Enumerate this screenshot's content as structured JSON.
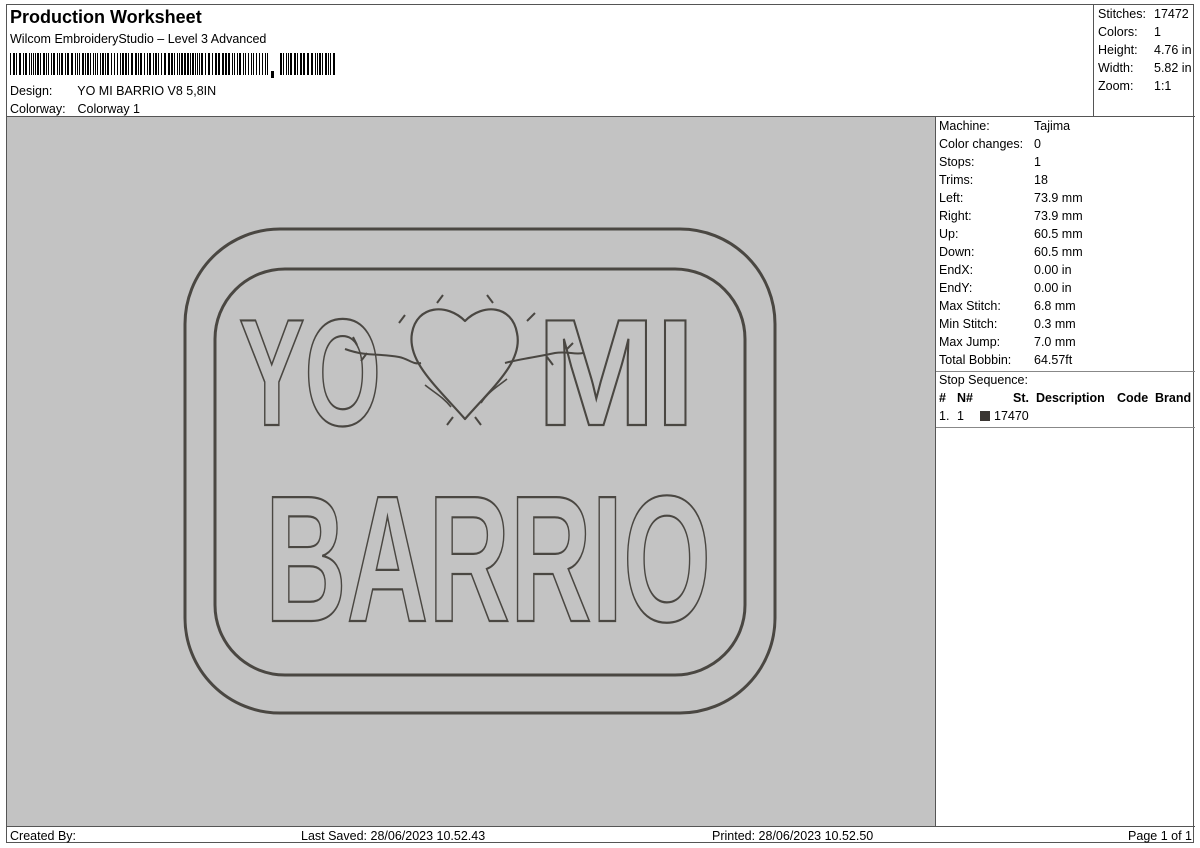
{
  "header": {
    "title": "Production Worksheet",
    "software": "Wilcom EmbroideryStudio – Level 3 Advanced",
    "barcode_label": "Barcode",
    "design_label": "Design:",
    "design_value": "YO MI BARRIO V8 5,8IN",
    "colorway_label": "Colorway:",
    "colorway_value": "Colorway 1"
  },
  "summary": {
    "stitches_label": "Stitches:",
    "stitches": "17472",
    "colors_label": "Colors:",
    "colors": "1",
    "height_label": "Height:",
    "height": "4.76 in",
    "width_label": "Width:",
    "width": "5.82 in",
    "zoom_label": "Zoom:",
    "zoom": "1:1"
  },
  "machine_info": [
    {
      "label": "Machine:",
      "value": "Tajima"
    },
    {
      "label": "Color changes:",
      "value": "0"
    },
    {
      "label": "Stops:",
      "value": "1"
    },
    {
      "label": "Trims:",
      "value": "18"
    },
    {
      "label": "Left:",
      "value": "73.9 mm"
    },
    {
      "label": "Right:",
      "value": "73.9 mm"
    },
    {
      "label": "Up:",
      "value": "60.5 mm"
    },
    {
      "label": "Down:",
      "value": "60.5 mm"
    },
    {
      "label": "EndX:",
      "value": "0.00 in"
    },
    {
      "label": "EndY:",
      "value": "0.00 in"
    },
    {
      "label": "Max Stitch:",
      "value": "6.8 mm"
    },
    {
      "label": "Min Stitch:",
      "value": "0.3 mm"
    },
    {
      "label": "Max Jump:",
      "value": "7.0 mm"
    },
    {
      "label": "Total Bobbin:",
      "value": "64.57ft"
    }
  ],
  "stop_sequence": {
    "title": "Stop Sequence:",
    "columns": [
      "#",
      "N#",
      "St.",
      "Description",
      "Code",
      "Brand"
    ],
    "rows": [
      {
        "num": "1.",
        "n": "1",
        "stitches": "17470",
        "description": "",
        "code": "",
        "brand": "",
        "color": "#3a3632"
      }
    ]
  },
  "design_preview": {
    "line1_left": "YO",
    "line1_right": "MI",
    "line2": "BARRIO",
    "thread_color": "#4a4742",
    "background": "#c3c3c3",
    "heart_icon": "heart-with-thorns-icon"
  },
  "footer": {
    "created_by": "Created By:",
    "last_saved": "Last Saved: 28/06/2023 10.52.43",
    "printed": "Printed: 28/06/2023 10.52.50",
    "page": "Page 1 of 1"
  }
}
